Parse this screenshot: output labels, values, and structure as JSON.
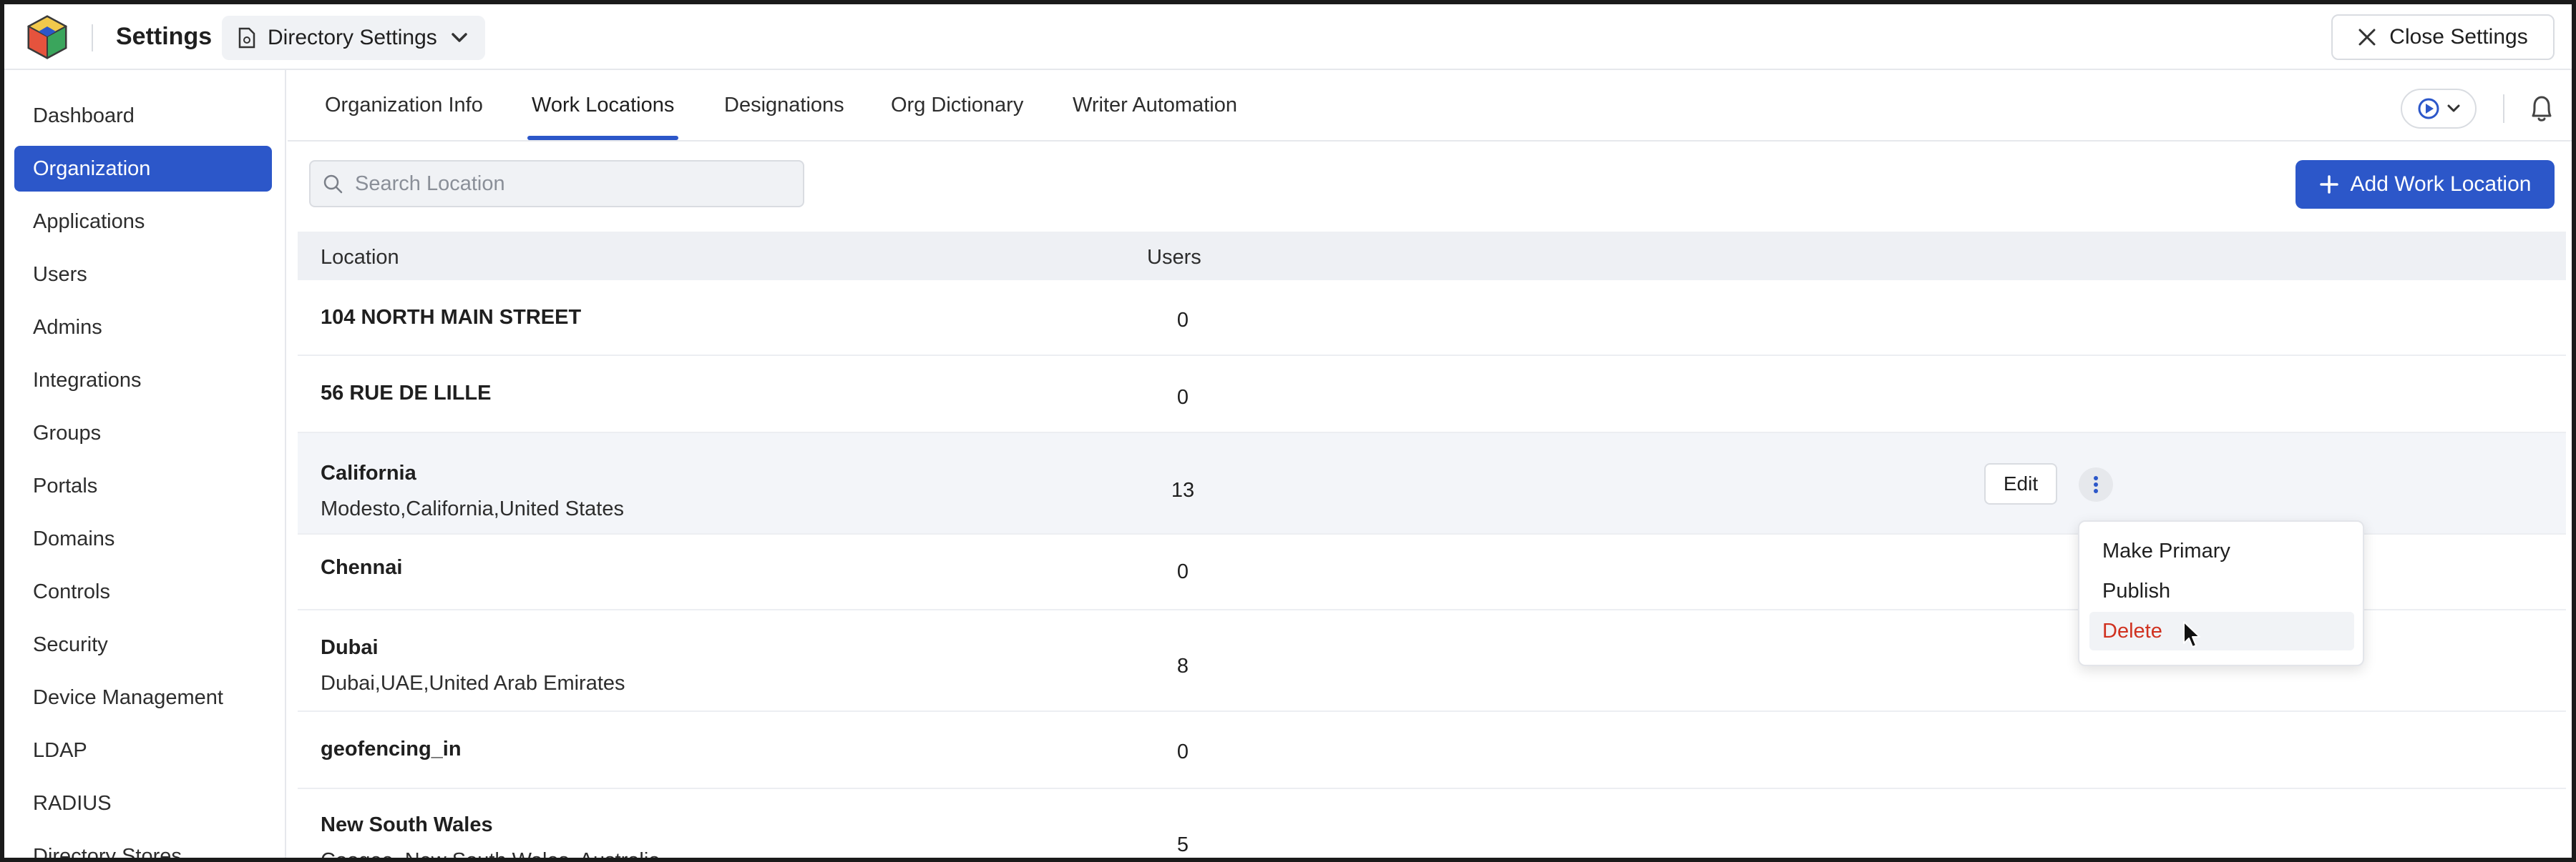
{
  "header": {
    "app_title": "Settings",
    "directory_select": "Directory Settings",
    "close_label": "Close Settings"
  },
  "sidebar": {
    "items": [
      {
        "label": "Dashboard",
        "active": false
      },
      {
        "label": "Organization",
        "active": true
      },
      {
        "label": "Applications",
        "active": false
      },
      {
        "label": "Users",
        "active": false
      },
      {
        "label": "Admins",
        "active": false
      },
      {
        "label": "Integrations",
        "active": false
      },
      {
        "label": "Groups",
        "active": false
      },
      {
        "label": "Portals",
        "active": false
      },
      {
        "label": "Domains",
        "active": false
      },
      {
        "label": "Controls",
        "active": false
      },
      {
        "label": "Security",
        "active": false
      },
      {
        "label": "Device Management",
        "active": false
      },
      {
        "label": "LDAP",
        "active": false
      },
      {
        "label": "RADIUS",
        "active": false
      },
      {
        "label": "Directory Stores",
        "active": false
      }
    ]
  },
  "tabs": [
    {
      "label": "Organization Info",
      "active": false
    },
    {
      "label": "Work Locations",
      "active": true
    },
    {
      "label": "Designations",
      "active": false
    },
    {
      "label": "Org Dictionary",
      "active": false
    },
    {
      "label": "Writer Automation",
      "active": false
    }
  ],
  "search": {
    "placeholder": "Search Location",
    "value": ""
  },
  "add_button": "Add Work Location",
  "table": {
    "columns": [
      "Location",
      "Users"
    ],
    "rows": [
      {
        "name": "104 NORTH MAIN STREET",
        "address": "",
        "users": "0"
      },
      {
        "name": "56 RUE DE LILLE",
        "address": "",
        "users": "0"
      },
      {
        "name": "California",
        "address": "Modesto,California,United States",
        "users": "13"
      },
      {
        "name": "Chennai",
        "address": "",
        "users": "0"
      },
      {
        "name": "Dubai",
        "address": "Dubai,UAE,United Arab Emirates",
        "users": "8"
      },
      {
        "name": "geofencing_in",
        "address": "",
        "users": "0"
      },
      {
        "name": "New South Wales",
        "address": "Coogee, New South Wales, Australia",
        "users": "5"
      }
    ],
    "edit_label": "Edit"
  },
  "row_menu": {
    "items": [
      "Make Primary",
      "Publish",
      "Delete"
    ]
  },
  "colors": {
    "accent": "#2c57c9",
    "danger": "#d0311f",
    "hover_row": "#f3f5f9",
    "header_bg": "#eef0f4"
  }
}
